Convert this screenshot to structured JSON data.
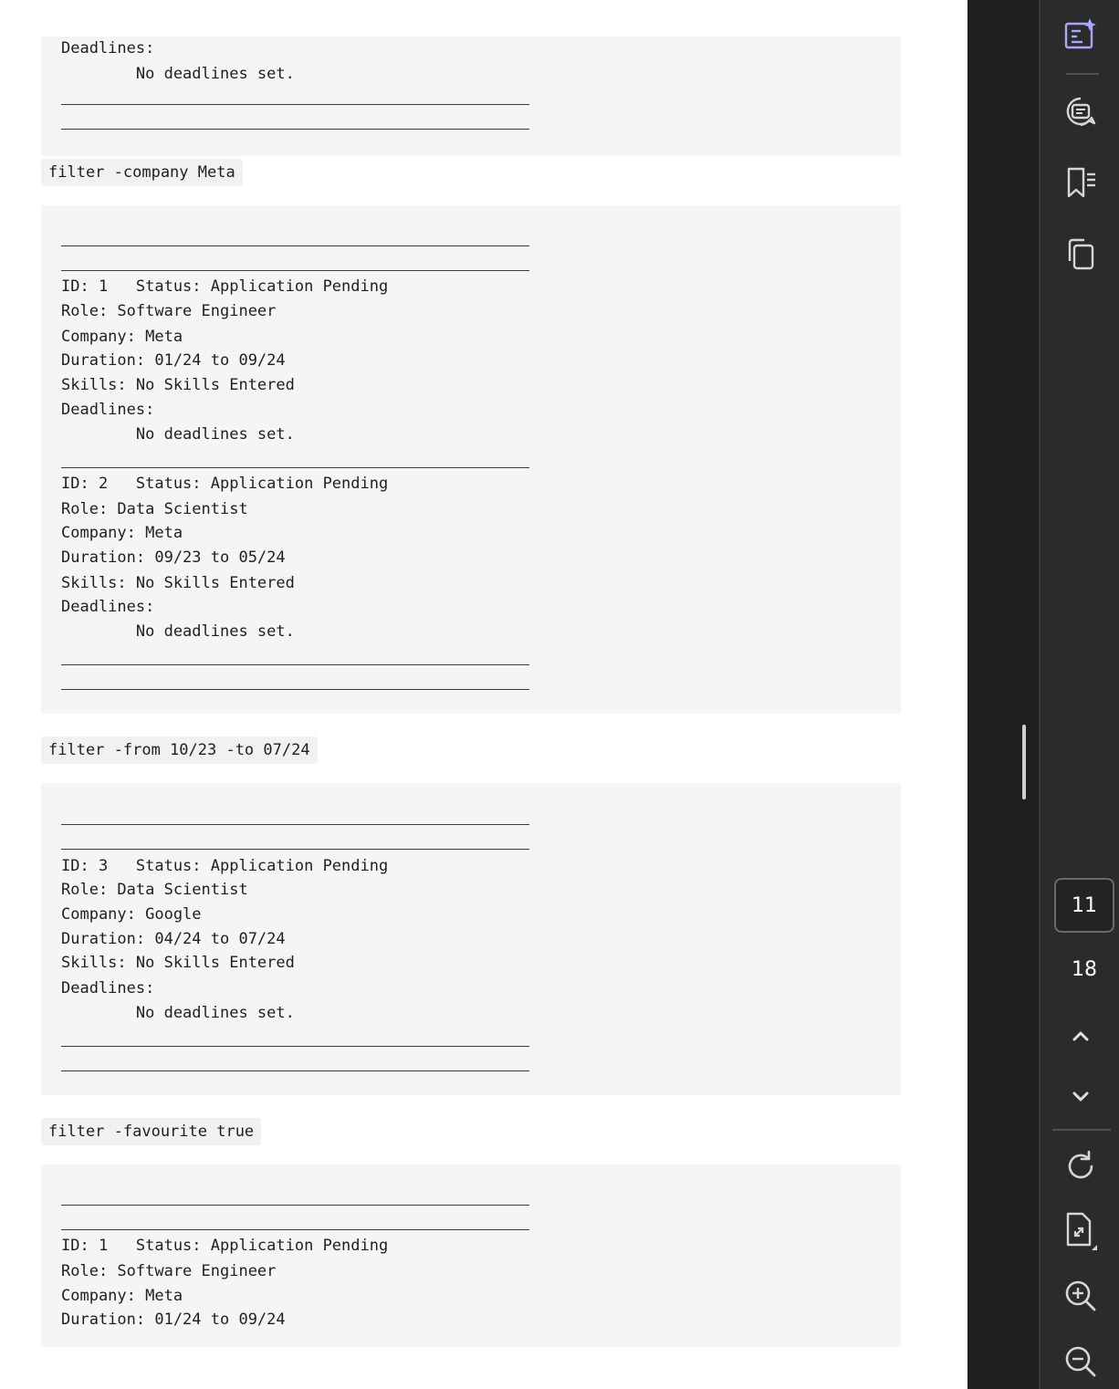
{
  "blocks": {
    "block0": {
      "lines": [
        "Deadlines:",
        "        No deadlines set."
      ]
    },
    "cmd1": "filter -company Meta",
    "block1": {
      "lines": [
        "ID: 1   Status: Application Pending",
        "Role: Software Engineer",
        "Company: Meta",
        "Duration: 01/24 to 09/24",
        "Skills: No Skills Entered",
        "Deadlines:",
        "        No deadlines set.",
        "ID: 2   Status: Application Pending",
        "Role: Data Scientist",
        "Company: Meta",
        "Duration: 09/23 to 05/24",
        "Skills: No Skills Entered",
        "Deadlines:",
        "        No deadlines set."
      ]
    },
    "cmd2": "filter -from 10/23 -to 07/24",
    "block2": {
      "lines": [
        "ID: 3   Status: Application Pending",
        "Role: Data Scientist",
        "Company: Google",
        "Duration: 04/24 to 07/24",
        "Skills: No Skills Entered",
        "Deadlines:",
        "        No deadlines set."
      ]
    },
    "cmd3": "filter -favourite true",
    "block3": {
      "lines": [
        "ID: 1   Status: Application Pending",
        "Role: Software Engineer",
        "Company: Meta",
        "Duration: 01/24 to 09/24"
      ]
    }
  },
  "toolbar": {
    "page_current": "11",
    "page_total": "18",
    "icons": [
      "ai-summary-icon",
      "comment-icon",
      "bookmarks-icon",
      "copy-pages-icon",
      "chevron-up-icon",
      "chevron-down-icon",
      "rotate-icon",
      "page-fit-icon",
      "zoom-in-icon",
      "zoom-out-icon"
    ],
    "accent_color": "#a9a6ff"
  }
}
